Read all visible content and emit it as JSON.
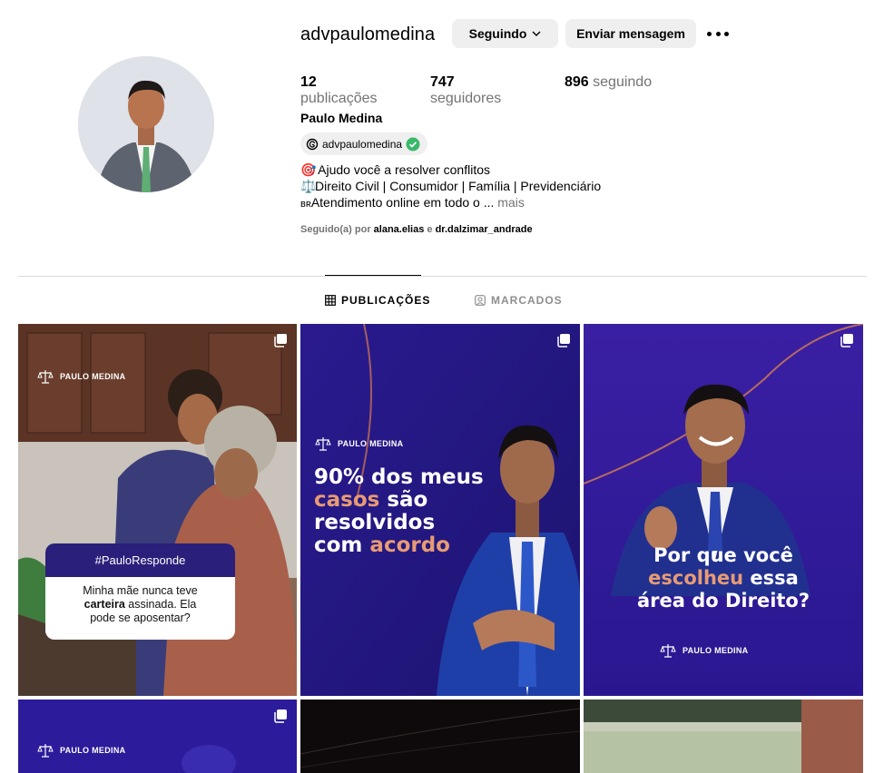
{
  "profile": {
    "username": "advpaulomedina",
    "follow_button": "Seguindo",
    "message_button": "Enviar mensagem",
    "stats": {
      "posts_count": "12",
      "posts_label": "publicações",
      "followers_count": "747",
      "followers_label": "seguidores",
      "following_count": "896",
      "following_label": "seguindo"
    },
    "full_name": "Paulo Medina",
    "threads_handle": "advpaulomedina",
    "bio": {
      "line1_emoji": "🎯",
      "line1": "Ajudo você a resolver conflitos",
      "line2_emoji": "⚖️",
      "line2": "Direito Civil | Consumidor | Família | Previdenciário",
      "line3_prefix": "ʙʀ",
      "line3": "Atendimento online em todo o ...",
      "more": "mais"
    },
    "followed_by": {
      "prefix": "Seguido(a) por",
      "user1": "alana.elias",
      "connector": "e",
      "user2": "dr.dalzimar_andrade"
    }
  },
  "tabs": {
    "publications": "PUBLICAÇÕES",
    "tagged": "MARCADOS"
  },
  "posts": {
    "brand": "PAULO MEDINA",
    "p1": {
      "tag": "#PauloResponde",
      "line1": "Minha mãe nunca teve",
      "bold": "carteira",
      "line2_rest": " assinada. Ela",
      "line3": "pode se aposentar?"
    },
    "p2": {
      "l1": "90% dos meus",
      "l2a": "casos",
      "l2b": " são",
      "l3": "resolvidos",
      "l4a": "com ",
      "l4b": "acordo"
    },
    "p3": {
      "l1": "Por que você",
      "l2a": "escolheu",
      "l2b": " essa",
      "l3": "área do Direito?"
    }
  },
  "colors": {
    "accent_text": "#e79b74",
    "post_purple": "#2d1f9a",
    "verified": "#3bb86a"
  }
}
